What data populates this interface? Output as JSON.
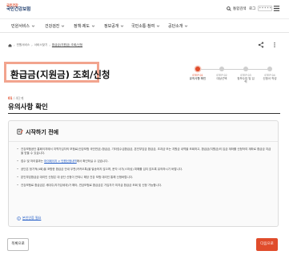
{
  "header": {
    "logo_tagline": "국민건강",
    "logo_name": "국민건강보험",
    "search_label": "통합검색",
    "login_label": "로그",
    "login_value": "* * * * *"
  },
  "gnb": [
    {
      "label": "민원서비스"
    },
    {
      "label": "건강검진"
    },
    {
      "label": "정책·제도"
    },
    {
      "label": "정보공개"
    },
    {
      "label": "국민소통·참여"
    },
    {
      "label": "공단소개"
    }
  ],
  "breadcrumb": [
    "민원서비스",
    "서비스찾기",
    "환급금(지원금) 조회/신청"
  ],
  "page_title": "환급금(지원금) 조회/신청",
  "steps": [
    {
      "num": "STEP 01",
      "label": "유의사항 확인"
    },
    {
      "num": "STEP 02",
      "label": "대상선택"
    },
    {
      "num": "STEP 03",
      "label": "정보수집 및 입력"
    },
    {
      "num": "STEP 04",
      "label": "신청서 작성"
    }
  ],
  "pager": {
    "current": "01",
    "total": "/ 4단계"
  },
  "section_title": "유의사항 확인",
  "notice": {
    "title": "시작하기 전에",
    "items": [
      "건강보험공단 홈페이지에서 지역가입자의 보험료(건강보험 국민연금) 환급금, 기타징수금환급금, 본인부담금 환급금, 초과금 또는 지원금 내역을 조회하고, 환급금(지원금)의 입금 계좌를 신청하여 계좌로 환급금 지급을 받을 수 있습니다.",
      "접수 및 처리결과는 ",
      "공단은 정기적(4회)을 포함한 환급금 안내 우편(카카오톡)을 발송하지 않으며, 문자 사기(스미싱) 피해를 입지 않도록 유의하시기 바랍니다.",
      "본인부담환급금 대리인 신청은 대 공단 신청이 안되니 해당 건강 보험 대리인 통해 신청바랍니다.",
      "건강보험료 환급금은 세대주(지가입세대)가 해야, 연금보험료 환급금은 가입자가 미지급 환급금 조회 및 신청 가능합니다."
    ],
    "item2_link": "마이페이지 > 민원신청내역",
    "item2_tail": "에서 확인하실 수 있습니다.",
    "help_label": "본인인증 필요"
  },
  "buttons": {
    "list_label": "목록으로",
    "next_label": "다음으로"
  },
  "colors": {
    "accent": "#e04c2b",
    "title_highlight": "#f2a48e",
    "link": "#1a56c5"
  }
}
